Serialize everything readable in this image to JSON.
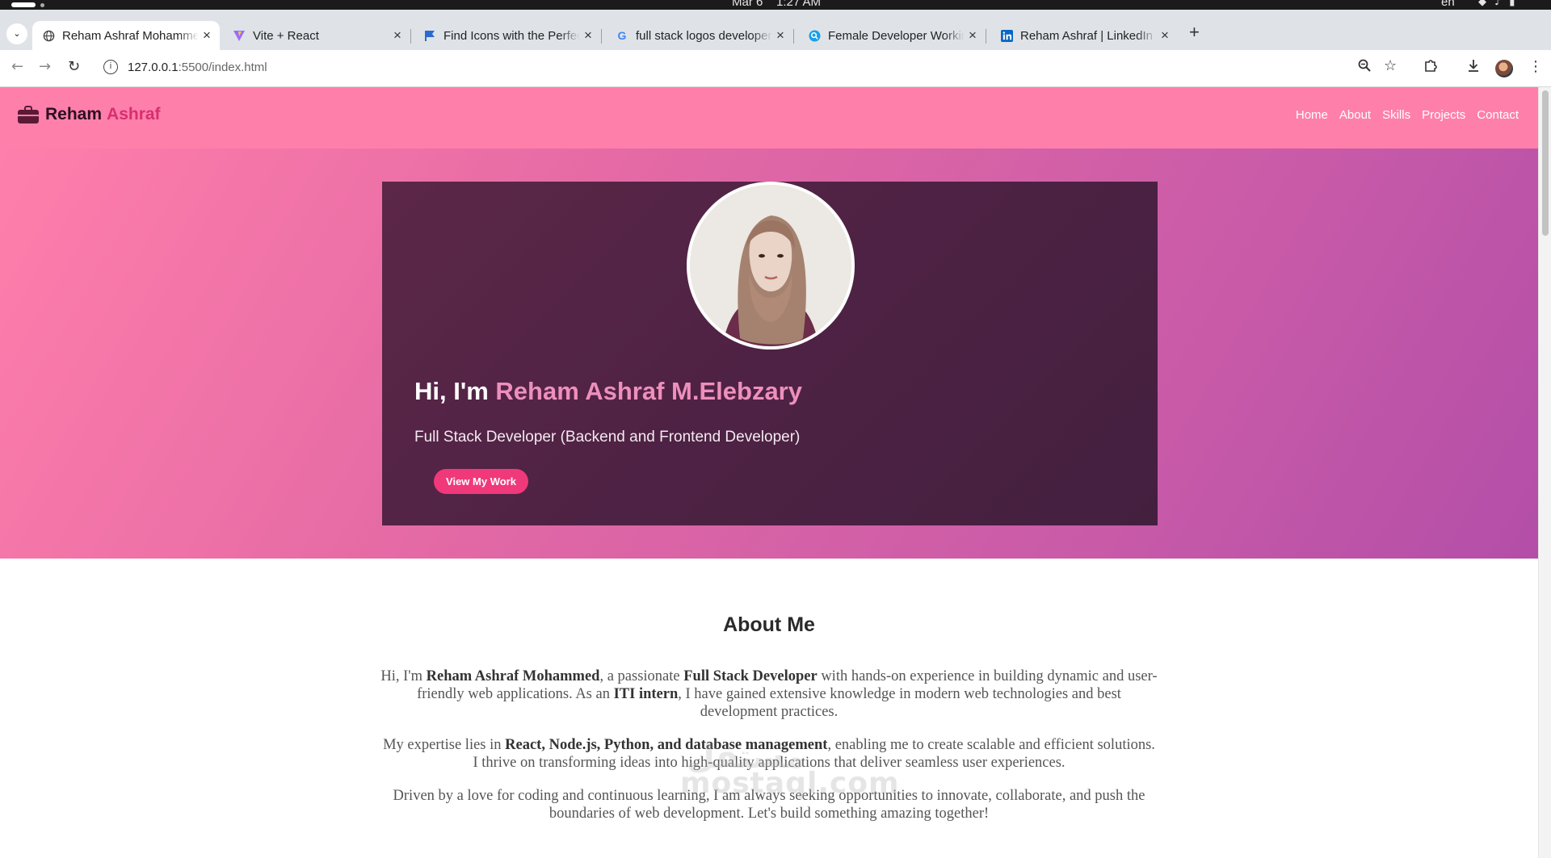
{
  "os": {
    "date": "Mar 6",
    "time": "1:27 AM",
    "lang": "en"
  },
  "tabs": [
    {
      "title": "Reham Ashraf Mohammed",
      "icon": "globe-icon",
      "active": true
    },
    {
      "title": "Vite + React",
      "icon": "vite-icon"
    },
    {
      "title": "Find Icons with the Perfect Look",
      "icon": "flag-icon"
    },
    {
      "title": "full stack logos developer",
      "icon": "google-icon"
    },
    {
      "title": "Female Developer Working",
      "icon": "search-circle-icon"
    },
    {
      "title": "Reham Ashraf | LinkedIn",
      "icon": "linkedin-icon"
    }
  ],
  "address": {
    "host": "127.0.0.1",
    "path": ":5500/index.html"
  },
  "site": {
    "brand_first": "Reham",
    "brand_second": "Ashraf",
    "nav": [
      "Home",
      "About",
      "Skills",
      "Projects",
      "Contact"
    ],
    "hero": {
      "greeting": "Hi, I'm",
      "name": "Reham Ashraf M.Elebzary",
      "subtitle": "Full Stack Developer (Backend and Frontend Developer)",
      "cta": "View My Work"
    },
    "about": {
      "heading": "About Me",
      "p1": [
        "Hi, I'm ",
        "Reham Ashraf Mohammed",
        ", a passionate ",
        "Full Stack Developer",
        " with hands-on experience in building dynamic and user-friendly web applications. As an ",
        "ITI intern",
        ", I have gained extensive knowledge in modern web technologies and best development practices."
      ],
      "p2": [
        "My expertise lies in ",
        "React, Node.js, Python, and database management",
        ", enabling me to create scalable and efficient solutions. I thrive on transforming ideas into high-quality applications that deliver seamless user experiences."
      ],
      "p3": "Driven by a love for coding and continuous learning, I am always seeking opportunities to innovate, collaborate, and push the boundaries of web development. Let's build something amazing together!"
    }
  },
  "watermark": {
    "latin": "mostaql.com",
    "arabic": "مستقل"
  },
  "colors": {
    "navbar": "#ff7fab",
    "accent": "#d62f6e",
    "card": "#4e2244",
    "cta": "#f0397a",
    "hero_name": "#ee8fbc"
  }
}
